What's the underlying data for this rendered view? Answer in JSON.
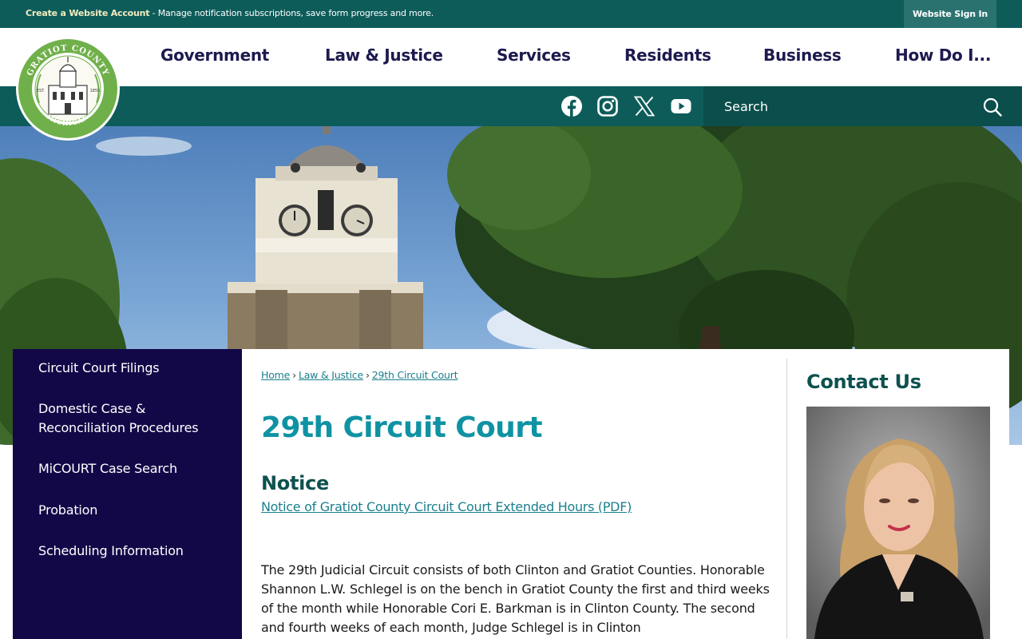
{
  "topbar": {
    "account_link": "Create a Website Account",
    "message": " - Manage notification subscriptions, save form progress and more.",
    "signin": "Website Sign In"
  },
  "logo": {
    "top_text": "GRATIOT COUNTY",
    "bottom_text": "MICHIGAN",
    "left_text": "EST.",
    "right_text": "1855"
  },
  "nav": {
    "items": [
      "Government",
      "Law & Justice",
      "Services",
      "Residents",
      "Business",
      "How Do I..."
    ]
  },
  "social": [
    "facebook-icon",
    "instagram-icon",
    "x-icon",
    "youtube-icon"
  ],
  "search": {
    "placeholder": "Search"
  },
  "sidebar": {
    "items": [
      "Circuit Court Filings",
      "Domestic Case & Reconciliation Procedures",
      "MiCOURT Case Search",
      "Probation",
      "Scheduling Information"
    ]
  },
  "breadcrumb": [
    "Home",
    "Law & Justice",
    "29th Circuit Court"
  ],
  "main": {
    "title": "29th Circuit Court",
    "notice_heading": "Notice",
    "notice_link": "Notice of Gratiot County Circuit Court Extended Hours (PDF)",
    "body": "The 29th Judicial Circuit consists of both Clinton and Gratiot Counties. Honorable Shannon L.W. Schlegel is on the bench in Gratiot County the first and third weeks of the month while Honorable Cori E. Barkman is in Clinton County. The second and fourth weeks of each month, Judge Schlegel is in Clinton"
  },
  "aside": {
    "heading": "Contact Us"
  },
  "colors": {
    "primary_teal": "#0d5c5a",
    "side_nav_navy": "#130847",
    "title_teal": "#0f93a3",
    "nav_text": "#1d1a4f"
  }
}
